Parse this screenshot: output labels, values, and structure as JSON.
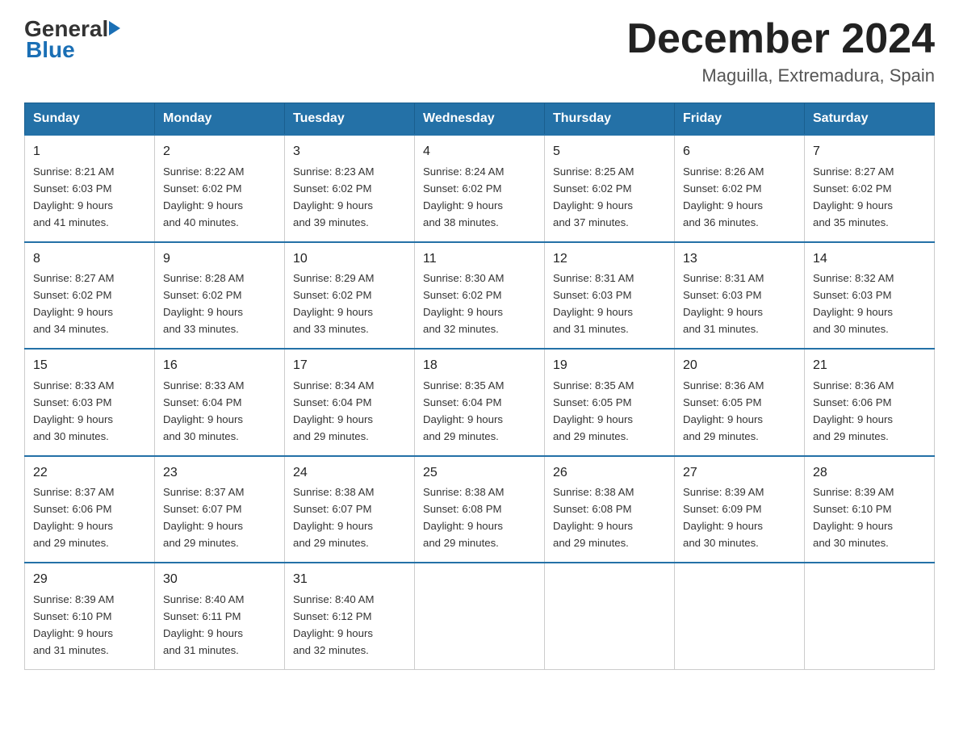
{
  "logo": {
    "part1": "General",
    "arrow": "▶",
    "part2": "Blue"
  },
  "title": "December 2024",
  "subtitle": "Maguilla, Extremadura, Spain",
  "days_of_week": [
    "Sunday",
    "Monday",
    "Tuesday",
    "Wednesday",
    "Thursday",
    "Friday",
    "Saturday"
  ],
  "weeks": [
    [
      {
        "num": "1",
        "sunrise": "8:21 AM",
        "sunset": "6:03 PM",
        "daylight": "9 hours and 41 minutes."
      },
      {
        "num": "2",
        "sunrise": "8:22 AM",
        "sunset": "6:02 PM",
        "daylight": "9 hours and 40 minutes."
      },
      {
        "num": "3",
        "sunrise": "8:23 AM",
        "sunset": "6:02 PM",
        "daylight": "9 hours and 39 minutes."
      },
      {
        "num": "4",
        "sunrise": "8:24 AM",
        "sunset": "6:02 PM",
        "daylight": "9 hours and 38 minutes."
      },
      {
        "num": "5",
        "sunrise": "8:25 AM",
        "sunset": "6:02 PM",
        "daylight": "9 hours and 37 minutes."
      },
      {
        "num": "6",
        "sunrise": "8:26 AM",
        "sunset": "6:02 PM",
        "daylight": "9 hours and 36 minutes."
      },
      {
        "num": "7",
        "sunrise": "8:27 AM",
        "sunset": "6:02 PM",
        "daylight": "9 hours and 35 minutes."
      }
    ],
    [
      {
        "num": "8",
        "sunrise": "8:27 AM",
        "sunset": "6:02 PM",
        "daylight": "9 hours and 34 minutes."
      },
      {
        "num": "9",
        "sunrise": "8:28 AM",
        "sunset": "6:02 PM",
        "daylight": "9 hours and 33 minutes."
      },
      {
        "num": "10",
        "sunrise": "8:29 AM",
        "sunset": "6:02 PM",
        "daylight": "9 hours and 33 minutes."
      },
      {
        "num": "11",
        "sunrise": "8:30 AM",
        "sunset": "6:02 PM",
        "daylight": "9 hours and 32 minutes."
      },
      {
        "num": "12",
        "sunrise": "8:31 AM",
        "sunset": "6:03 PM",
        "daylight": "9 hours and 31 minutes."
      },
      {
        "num": "13",
        "sunrise": "8:31 AM",
        "sunset": "6:03 PM",
        "daylight": "9 hours and 31 minutes."
      },
      {
        "num": "14",
        "sunrise": "8:32 AM",
        "sunset": "6:03 PM",
        "daylight": "9 hours and 30 minutes."
      }
    ],
    [
      {
        "num": "15",
        "sunrise": "8:33 AM",
        "sunset": "6:03 PM",
        "daylight": "9 hours and 30 minutes."
      },
      {
        "num": "16",
        "sunrise": "8:33 AM",
        "sunset": "6:04 PM",
        "daylight": "9 hours and 30 minutes."
      },
      {
        "num": "17",
        "sunrise": "8:34 AM",
        "sunset": "6:04 PM",
        "daylight": "9 hours and 29 minutes."
      },
      {
        "num": "18",
        "sunrise": "8:35 AM",
        "sunset": "6:04 PM",
        "daylight": "9 hours and 29 minutes."
      },
      {
        "num": "19",
        "sunrise": "8:35 AM",
        "sunset": "6:05 PM",
        "daylight": "9 hours and 29 minutes."
      },
      {
        "num": "20",
        "sunrise": "8:36 AM",
        "sunset": "6:05 PM",
        "daylight": "9 hours and 29 minutes."
      },
      {
        "num": "21",
        "sunrise": "8:36 AM",
        "sunset": "6:06 PM",
        "daylight": "9 hours and 29 minutes."
      }
    ],
    [
      {
        "num": "22",
        "sunrise": "8:37 AM",
        "sunset": "6:06 PM",
        "daylight": "9 hours and 29 minutes."
      },
      {
        "num": "23",
        "sunrise": "8:37 AM",
        "sunset": "6:07 PM",
        "daylight": "9 hours and 29 minutes."
      },
      {
        "num": "24",
        "sunrise": "8:38 AM",
        "sunset": "6:07 PM",
        "daylight": "9 hours and 29 minutes."
      },
      {
        "num": "25",
        "sunrise": "8:38 AM",
        "sunset": "6:08 PM",
        "daylight": "9 hours and 29 minutes."
      },
      {
        "num": "26",
        "sunrise": "8:38 AM",
        "sunset": "6:08 PM",
        "daylight": "9 hours and 29 minutes."
      },
      {
        "num": "27",
        "sunrise": "8:39 AM",
        "sunset": "6:09 PM",
        "daylight": "9 hours and 30 minutes."
      },
      {
        "num": "28",
        "sunrise": "8:39 AM",
        "sunset": "6:10 PM",
        "daylight": "9 hours and 30 minutes."
      }
    ],
    [
      {
        "num": "29",
        "sunrise": "8:39 AM",
        "sunset": "6:10 PM",
        "daylight": "9 hours and 31 minutes."
      },
      {
        "num": "30",
        "sunrise": "8:40 AM",
        "sunset": "6:11 PM",
        "daylight": "9 hours and 31 minutes."
      },
      {
        "num": "31",
        "sunrise": "8:40 AM",
        "sunset": "6:12 PM",
        "daylight": "9 hours and 32 minutes."
      },
      null,
      null,
      null,
      null
    ]
  ]
}
